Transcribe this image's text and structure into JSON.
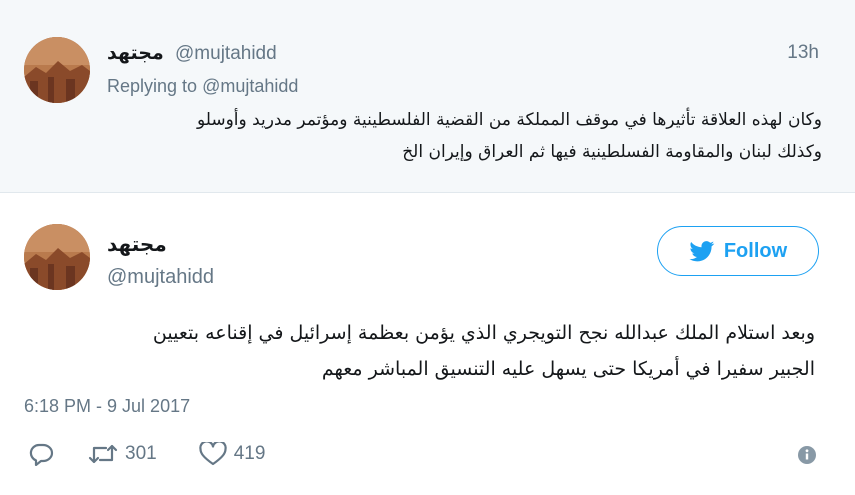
{
  "reply_tweet": {
    "name": "مجتهد",
    "handle": "@mujtahidd",
    "time": "13h",
    "replying_prefix": "Replying to",
    "replying_to": "@mujtahidd",
    "text_line1": "وكان لهذه العلاقة تأثيرها في موقف المملكة من القضية الفلسطينية ومؤتمر مدريد وأوسلو",
    "text_line2": "وكذلك لبنان والمقاومة الفسلطينية فيها ثم العراق وإيران الخ"
  },
  "main_tweet": {
    "name": "مجتهد",
    "handle": "@mujtahidd",
    "follow_label": "Follow",
    "text_line1": "وبعد استلام الملك عبدالله نجح التويجري الذي يؤمن بعظمة إسرائيل في إقناعه بتعيين",
    "text_line2": "الجبير سفيرا في أمريكا حتى يسهل عليه التنسيق المباشر معهم",
    "date": "6:18 PM - 9 Jul 2017",
    "retweet_count": "301",
    "like_count": "419"
  },
  "icons": {
    "reply": "reply-icon",
    "retweet": "retweet-icon",
    "like": "heart-icon",
    "info": "info-icon",
    "follow": "twitter-bird-icon"
  },
  "colors": {
    "accent": "#1da1f2",
    "secondary_text": "#657786",
    "reply_background": "#f5f8fa"
  }
}
